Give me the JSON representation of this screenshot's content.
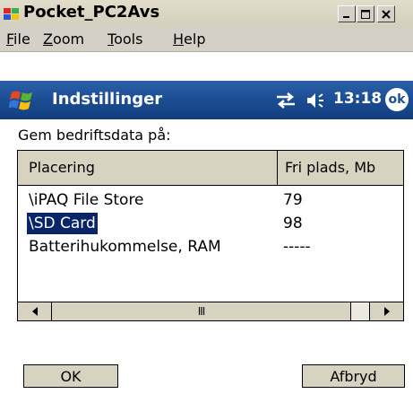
{
  "window": {
    "title": "Pocket_PC2Avs",
    "icon": "pocket-pc-icon",
    "buttons": [
      "minimize-icon",
      "maximize-icon",
      "close-icon"
    ]
  },
  "menubar": {
    "items": [
      {
        "label": "File"
      },
      {
        "label": "Zoom"
      },
      {
        "label": "Tools"
      },
      {
        "label": "Help"
      }
    ]
  },
  "navbar": {
    "start_icon": "windows-flag-icon",
    "title": "Indstillinger",
    "connectivity_icon": "sync-arrows-icon",
    "volume_icon": "speaker-icon",
    "time": "13:18",
    "ok_label": "ok"
  },
  "form": {
    "heading": "Gem bedriftsdata på:"
  },
  "listview": {
    "columns": [
      "Placering",
      "Fri plads, Mb"
    ],
    "rows": [
      {
        "location": "\\iPAQ File Store",
        "free": "79",
        "selected": false
      },
      {
        "location": "\\SD Card",
        "free": "98",
        "selected": true
      },
      {
        "location": "Batterihukommelse, RAM",
        "free": "-----",
        "selected": false
      }
    ]
  },
  "scrollbar": {
    "left_icon": "scroll-left-arrow-icon",
    "right_icon": "scroll-right-arrow-icon",
    "thumb_grip": "III"
  },
  "buttons": {
    "ok": "OK",
    "cancel": "Afbryd"
  },
  "colors": {
    "nav_blue": "#1d4f95",
    "selection": "#0a246a"
  }
}
